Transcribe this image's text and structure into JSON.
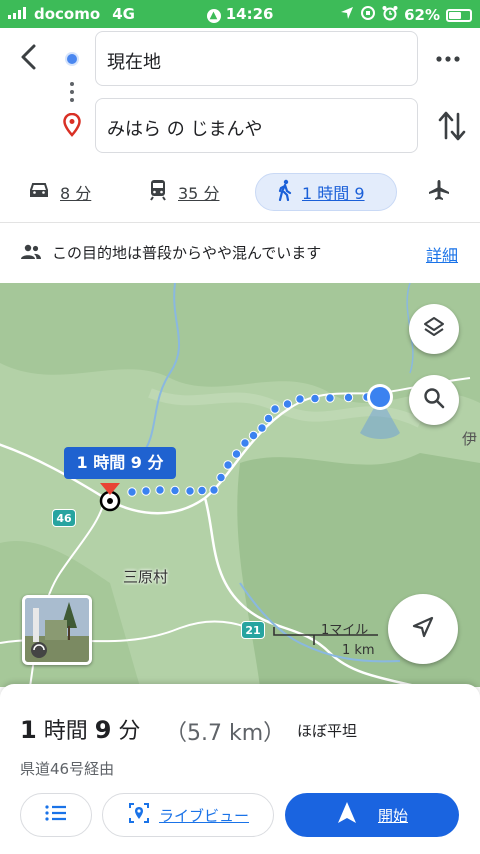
{
  "status_bar": {
    "carrier": "docomo",
    "network": "4G",
    "time": "14:26",
    "battery": "62%",
    "battery_fraction": 0.62
  },
  "header": {
    "origin": "現在地",
    "destination": "みはら の じまんや"
  },
  "modes": [
    {
      "name": "car",
      "icon": "car-icon",
      "time": "8 分"
    },
    {
      "name": "transit",
      "icon": "train-icon",
      "time": "35 分"
    },
    {
      "name": "walk",
      "icon": "walking-icon",
      "time": "1 時間 9"
    },
    {
      "name": "flight",
      "icon": "airplane-icon",
      "time": ""
    }
  ],
  "notice": {
    "text": "この目的地は普段からやや混んでいます",
    "link": "詳細"
  },
  "map": {
    "route_bubble": "1 時間 9 分",
    "place_label": "三原村",
    "road_46": "46",
    "road_21": "21",
    "scale_top": "1マイル",
    "scale_bottom": "1 km",
    "edge_label": "伊",
    "colors": {
      "route": "#3b82f0",
      "map_bg": "#aecda4",
      "map_dark": "#8fb386"
    }
  },
  "summary": {
    "duration_num1": "1",
    "duration_word1": "時間",
    "duration_num2": "9",
    "duration_word2": "分",
    "distance": "（5.7 km）",
    "terrain": "ほぼ平坦",
    "via": "県道46号経由"
  },
  "actions": {
    "live_view": "ライブビュー",
    "start": "開始"
  }
}
